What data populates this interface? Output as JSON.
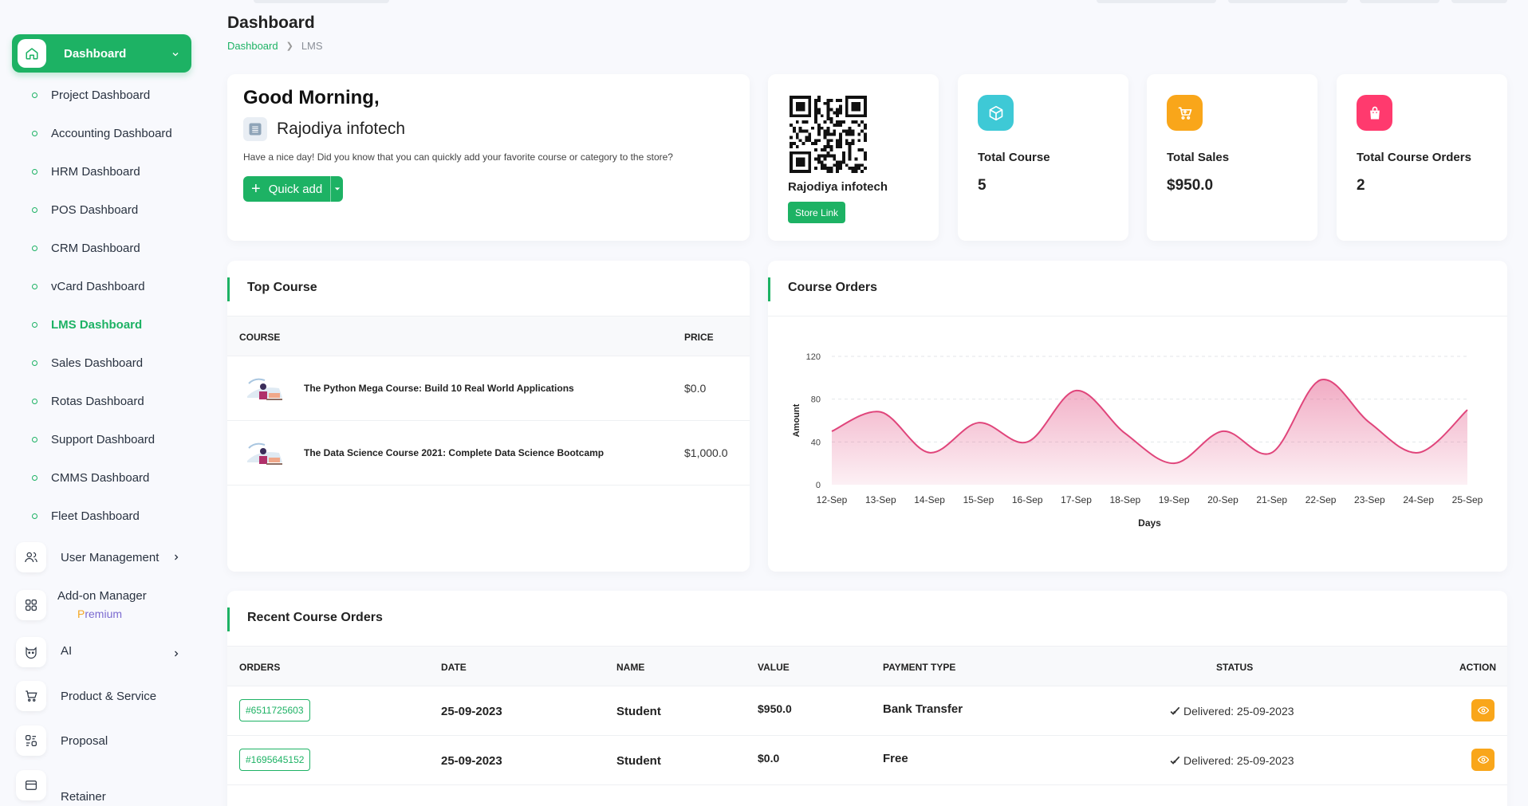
{
  "sidebar": {
    "dashboard_label": "Dashboard",
    "sub_items": [
      {
        "label": "Project Dashboard"
      },
      {
        "label": "Accounting Dashboard"
      },
      {
        "label": "HRM Dashboard"
      },
      {
        "label": "POS Dashboard"
      },
      {
        "label": "CRM Dashboard"
      },
      {
        "label": "vCard Dashboard"
      },
      {
        "label": "LMS Dashboard",
        "active": true
      },
      {
        "label": "Sales Dashboard"
      },
      {
        "label": "Rotas Dashboard"
      },
      {
        "label": "Support Dashboard"
      },
      {
        "label": "CMMS Dashboard"
      },
      {
        "label": "Fleet Dashboard"
      }
    ],
    "items": [
      {
        "label": "User Management",
        "icon": "users-icon"
      },
      {
        "label": "Add-on Manager",
        "icon": "grid-icon",
        "badge": "Premium"
      },
      {
        "label": "AI",
        "icon": "ai-icon"
      },
      {
        "label": "Product & Service",
        "icon": "cart-icon"
      },
      {
        "label": "Proposal",
        "icon": "proposal-icon"
      },
      {
        "label": "Retainer",
        "icon": "retainer-icon"
      }
    ],
    "premium_first": "P",
    "premium_rest": "remium"
  },
  "header": {
    "title": "Dashboard",
    "breadcrumb": [
      "Dashboard",
      "LMS"
    ]
  },
  "welcome": {
    "greeting": "Good Morning,",
    "company": "Rajodiya infotech",
    "message": "Have a nice day! Did you know that you can quickly add your favorite course or category to the store?",
    "quick_add": "Quick add"
  },
  "store": {
    "name": "Rajodiya infotech",
    "link_label": "Store Link"
  },
  "stats": [
    {
      "label": "Total Course",
      "value": "5",
      "color": "#3ec9d6",
      "icon": "box-icon"
    },
    {
      "label": "Total Sales",
      "value": "$950.0",
      "color": "#f9a61a",
      "icon": "cart-icon"
    },
    {
      "label": "Total Course Orders",
      "value": "2",
      "color": "#ff3a6e",
      "icon": "bag-icon"
    }
  ],
  "top_course": {
    "title": "Top Course",
    "columns": [
      "COURSE",
      "PRICE"
    ],
    "rows": [
      {
        "name": "The Python Mega Course: Build 10 Real World Applications",
        "price": "$0.0"
      },
      {
        "name": "The Data Science Course 2021: Complete Data Science Bootcamp",
        "price": "$1,000.0"
      }
    ]
  },
  "course_orders": {
    "title": "Course Orders"
  },
  "chart_data": {
    "type": "area",
    "x": [
      "12-Sep",
      "13-Sep",
      "14-Sep",
      "15-Sep",
      "16-Sep",
      "17-Sep",
      "18-Sep",
      "19-Sep",
      "20-Sep",
      "21-Sep",
      "22-Sep",
      "23-Sep",
      "24-Sep",
      "25-Sep"
    ],
    "values": [
      50,
      68,
      30,
      58,
      40,
      88,
      48,
      20,
      50,
      30,
      98,
      58,
      30,
      70
    ],
    "yticks": [
      "0",
      "40",
      "80",
      "120"
    ],
    "ylim": [
      0,
      120
    ],
    "xlabel": "Days",
    "ylabel": "Amount",
    "color": "#e0457b",
    "grid": true
  },
  "recent_orders": {
    "title": "Recent Course Orders",
    "columns": [
      "ORDERS",
      "DATE",
      "NAME",
      "VALUE",
      "PAYMENT TYPE",
      "STATUS",
      "ACTION"
    ],
    "rows": [
      {
        "order": "#6511725603",
        "date": "25-09-2023",
        "name": "Student",
        "value": "$950.0",
        "payment": "Bank Transfer",
        "status": "Delivered: 25-09-2023"
      },
      {
        "order": "#1695645152",
        "date": "25-09-2023",
        "name": "Student",
        "value": "$0.0",
        "payment": "Free",
        "status": "Delivered: 25-09-2023"
      }
    ]
  },
  "colors": {
    "primary": "#1db264",
    "warning": "#f9a61a"
  }
}
